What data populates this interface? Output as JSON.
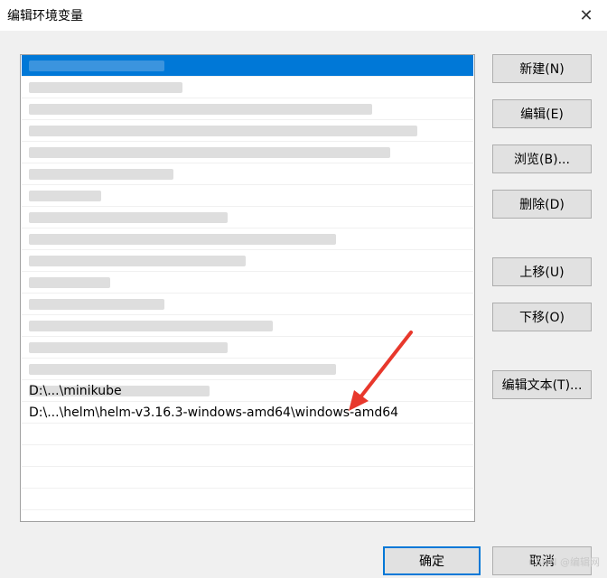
{
  "window": {
    "title": "编辑环境变量",
    "close_glyph": "✕"
  },
  "list": {
    "rows": [
      "",
      "",
      "",
      "",
      "",
      "",
      "",
      "",
      "",
      "",
      "",
      "",
      "",
      "",
      "",
      "",
      "D:\\...\\minikube",
      "D:\\...\\helm\\helm-v3.16.3-windows-amd64\\windows-amd64"
    ]
  },
  "buttons": {
    "new": "新建(N)",
    "edit": "编辑(E)",
    "browse": "浏览(B)...",
    "delete": "删除(D)",
    "move_up": "上移(U)",
    "move_down": "下移(O)",
    "edit_text": "编辑文本(T)...",
    "ok": "确定",
    "cancel": "取消"
  },
  "watermark": "CSDN @编辑网",
  "colors": {
    "selection": "#0078d7",
    "arrow": "#e8382c"
  }
}
